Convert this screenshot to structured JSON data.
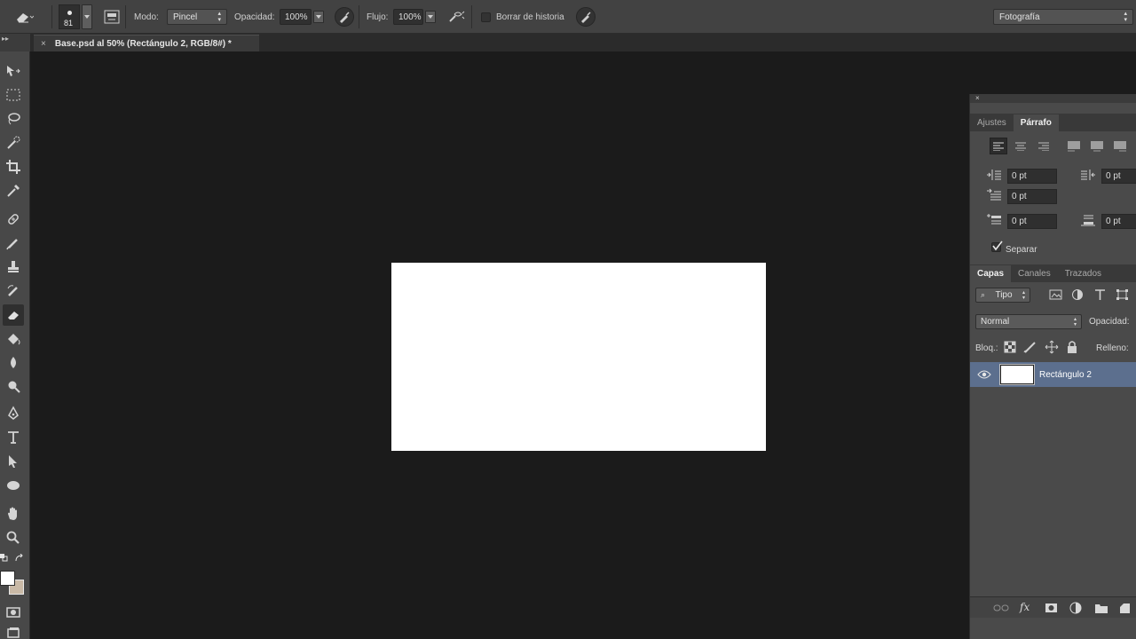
{
  "options_bar": {
    "brush_size": "81",
    "mode_label": "Modo:",
    "mode_value": "Pincel",
    "opacity_label": "Opacidad:",
    "opacity_value": "100%",
    "flow_label": "Flujo:",
    "flow_value": "100%",
    "erase_history_label": "Borrar de historia",
    "workspace_value": "Fotografía"
  },
  "document_tab": {
    "close_glyph": "×",
    "title": "Base.psd al 50% (Rectángulo 2, RGB/8#) *"
  },
  "paragraph_panel": {
    "tabs": [
      {
        "label": "Ajustes"
      },
      {
        "label": "Párrafo"
      }
    ],
    "indent_left": "0 pt",
    "indent_right": "0 pt",
    "indent_first": "0 pt",
    "space_before": "0 pt",
    "space_after": "0 pt",
    "hyphenate_label": "Separar",
    "hyphenate_checked": true
  },
  "layers_panel": {
    "tabs": [
      {
        "label": "Capas"
      },
      {
        "label": "Canales"
      },
      {
        "label": "Trazados"
      }
    ],
    "filter_value": "Tipo",
    "blend_mode": "Normal",
    "opacity_label": "Opacidad:",
    "lock_label": "Bloq.:",
    "fill_label": "Relleno:",
    "layers": [
      {
        "name": "Rectángulo 2",
        "visible": true,
        "selected": true
      }
    ]
  },
  "colors": {
    "accent_selection": "#5c6f8e",
    "foreground_swatch": "#ffffff",
    "background_swatch": "#c9b9a6"
  }
}
